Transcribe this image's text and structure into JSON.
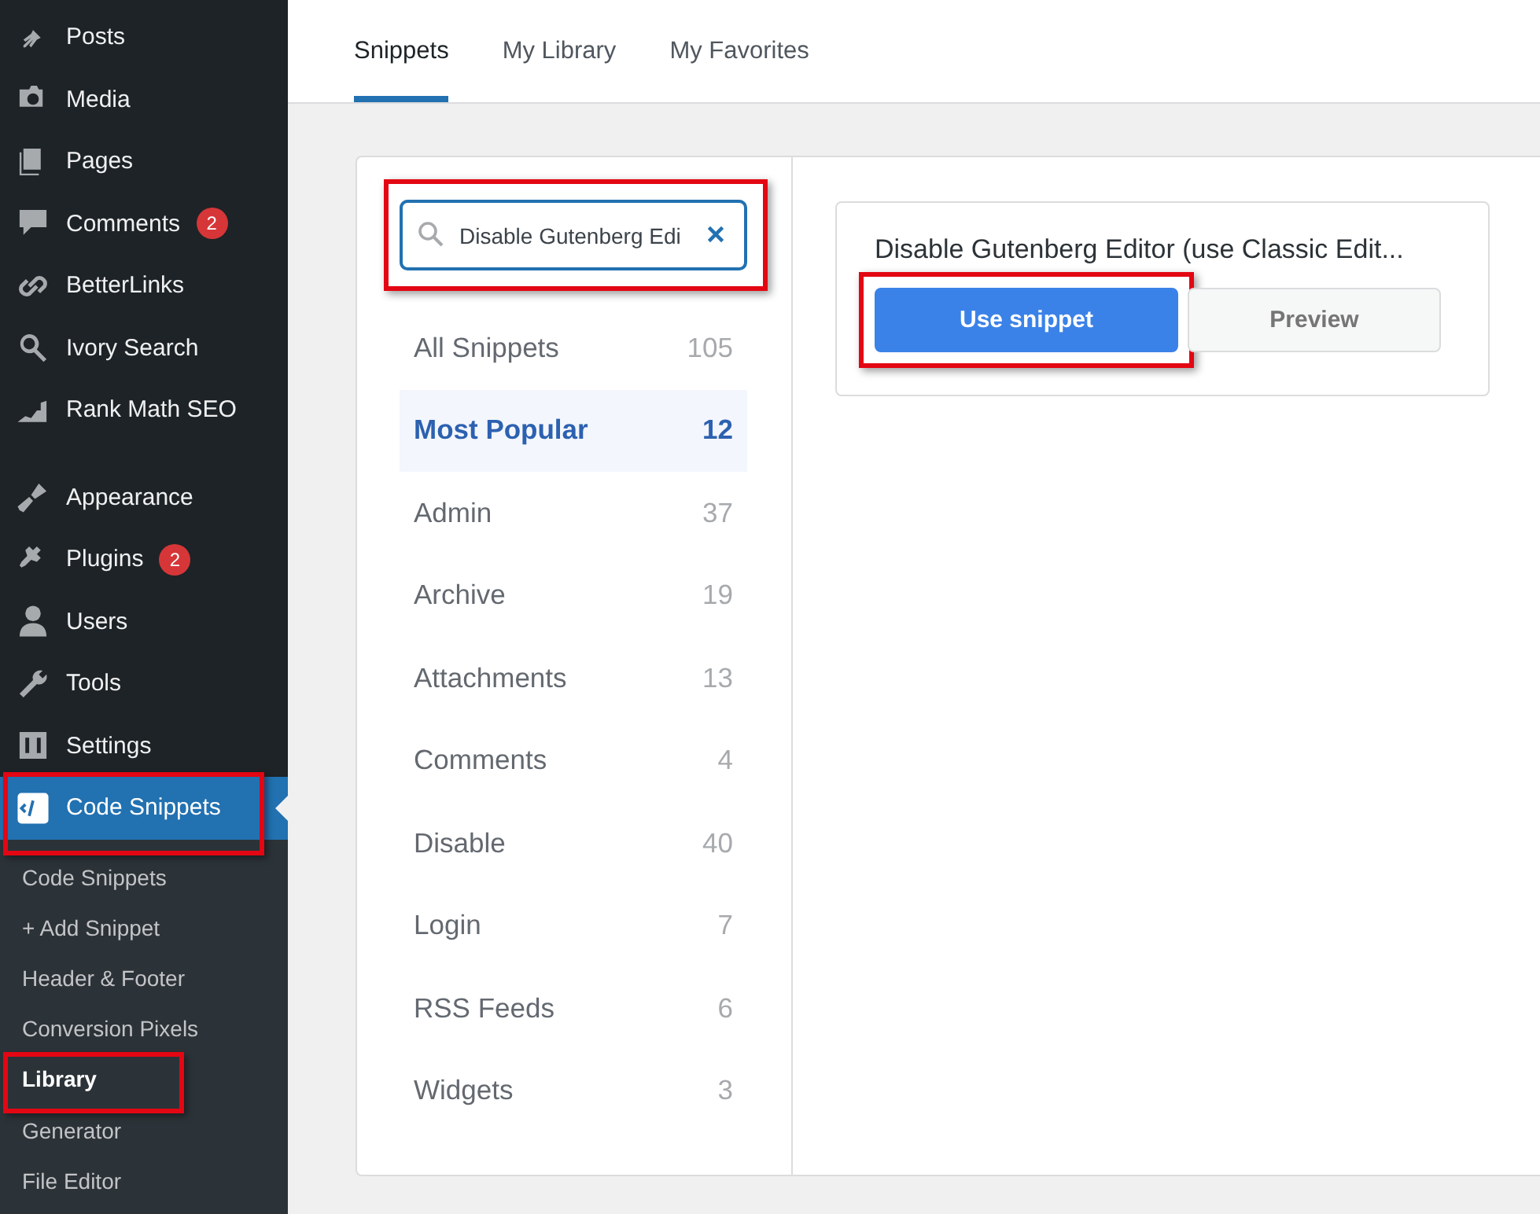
{
  "sidebar": {
    "menu_groups": [
      [
        {
          "label": "Posts",
          "selected": false,
          "highlighted": false
        },
        {
          "label": "Media",
          "selected": false,
          "highlighted": false
        },
        {
          "label": "Pages",
          "selected": false,
          "highlighted": false
        },
        {
          "label": "Comments",
          "badge": "2",
          "selected": false,
          "highlighted": false
        },
        {
          "label": "BetterLinks",
          "selected": false,
          "highlighted": false
        },
        {
          "label": "Ivory Search",
          "selected": false,
          "highlighted": false
        },
        {
          "label": "Rank Math SEO",
          "selected": false,
          "highlighted": false
        }
      ],
      [
        {
          "label": "Appearance",
          "selected": false,
          "highlighted": false
        },
        {
          "label": "Plugins",
          "badge": "2",
          "selected": false,
          "highlighted": false
        },
        {
          "label": "Users",
          "selected": false,
          "highlighted": false
        },
        {
          "label": "Tools",
          "selected": false,
          "highlighted": false
        },
        {
          "label": "Settings",
          "selected": false,
          "highlighted": false
        },
        {
          "label": "Code Snippets",
          "selected": true,
          "highlighted": true
        }
      ]
    ],
    "submenu": [
      {
        "label": "Code Snippets",
        "selected": false,
        "highlighted": false
      },
      {
        "label": "+ Add Snippet",
        "selected": false,
        "highlighted": false
      },
      {
        "label": "Header & Footer",
        "selected": false,
        "highlighted": false
      },
      {
        "label": "Conversion Pixels",
        "selected": false,
        "highlighted": false
      },
      {
        "label": "Library",
        "selected": true,
        "highlighted": true
      },
      {
        "label": "Generator",
        "selected": false,
        "highlighted": false
      },
      {
        "label": "File Editor",
        "selected": false,
        "highlighted": false
      }
    ]
  },
  "tabs": [
    {
      "label": "Snippets",
      "selected": true
    },
    {
      "label": "My Library",
      "selected": false
    },
    {
      "label": "My Favorites",
      "selected": false
    }
  ],
  "search": {
    "value": "Disable Gutenberg Edi",
    "highlighted": true
  },
  "categories": [
    {
      "label": "All Snippets",
      "count": "105",
      "selected": false
    },
    {
      "label": "Most Popular",
      "count": "12",
      "selected": true
    },
    {
      "label": "Admin",
      "count": "37",
      "selected": false
    },
    {
      "label": "Archive",
      "count": "19",
      "selected": false
    },
    {
      "label": "Attachments",
      "count": "13",
      "selected": false
    },
    {
      "label": "Comments",
      "count": "4",
      "selected": false
    },
    {
      "label": "Disable",
      "count": "40",
      "selected": false
    },
    {
      "label": "Login",
      "count": "7",
      "selected": false
    },
    {
      "label": "RSS Feeds",
      "count": "6",
      "selected": false
    },
    {
      "label": "Widgets",
      "count": "3",
      "selected": false
    }
  ],
  "snippet_card": {
    "title": "Disable Gutenberg Editor (use Classic Edit...",
    "buttons": [
      {
        "label": "Use snippet",
        "kind": "primary",
        "highlighted": true
      },
      {
        "label": "Preview",
        "kind": "secondary",
        "highlighted": false
      }
    ]
  }
}
